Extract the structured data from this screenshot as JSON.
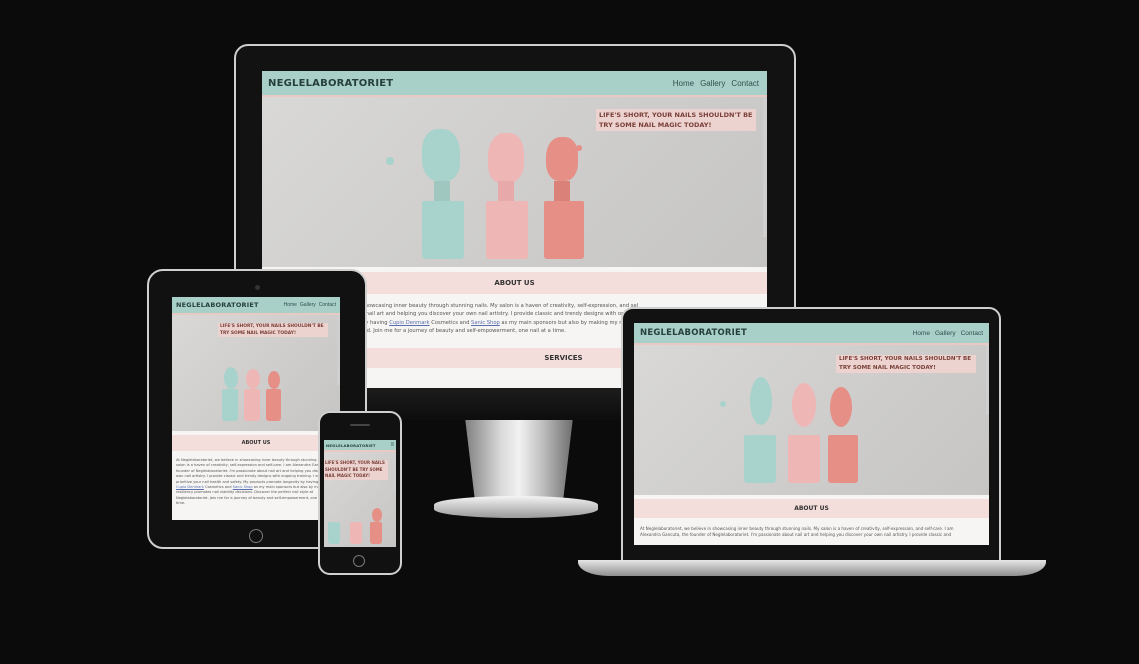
{
  "site": {
    "logo": "NEGLELABORATORIET",
    "nav": [
      "Home",
      "Gallery",
      "Contact"
    ],
    "hero_tagline": "LIFE'S SHORT, YOUR NAILS SHOULDN'T BE TRY SOME NAIL MAGIC TODAY!",
    "about_heading": "ABOUT US",
    "services_heading": "SERVICES",
    "about_text": {
      "monitor_line1": "showcasing inner beauty through stunning nails. My salon is a haven of creativity, self-expression, and sel",
      "monitor_line2": "t nail art and helping you discover your own nail artistry. I provide classic and trendy designs with on",
      "monitor_line3_pre": "by having ",
      "link1": "Cupio Denmark",
      "monitor_line3_mid1": " Cosmetics and ",
      "link2": "Sanic Shop",
      "monitor_line3_post": " as my main sponsors but also by making my n",
      "monitor_line4": "ied. Join me for a journey of beauty and self-empowerment, one nail at a time.",
      "laptop_line1": "At Neglelaboratoriet, we believe in showcasing inner beauty through stunning nails. My salon is a haven of creativity, self-expression, and self-care. I am",
      "laptop_line2": "Alexandra Gancuta, the founder of Neglelaboratoriet. I'm passionate about nail art and helping you discover your own nail artistry. I provide classic and",
      "tablet_line1": "At Neglelaboratoriet, we believe in showcasing inner beauty through stunning nail",
      "tablet_line2": "salon is a haven of creativity, self-expression and self-care. I am Alexandra Gancu",
      "tablet_line3": "founder of Neglelaboratoriet. I'm passionate about nail art and helping you discov",
      "tablet_line4": "own nail artistry. I provide classic and trendy designs with ongoing training. I ensu",
      "tablet_line5": "prioritize your nail health and safety. My products promote longevity by having",
      "tablet_line6": "Cosmetics and",
      "tablet_line6b": "as my main sponsors but also by making my",
      "tablet_line7": "resiliency promotes nail viability decisions. Discover the perfect nail style at",
      "tablet_line8": "Neglelaboratoriet. Join me for a journey of beauty and self-empowerment, one nai",
      "tablet_line9": "time."
    }
  },
  "colors": {
    "nav": "#a9cfc9",
    "tag": "#ecd3cf",
    "bottle_teal": "#a8d3cc",
    "bottle_pink": "#efb6b6",
    "bottle_coral": "#e58f86"
  }
}
